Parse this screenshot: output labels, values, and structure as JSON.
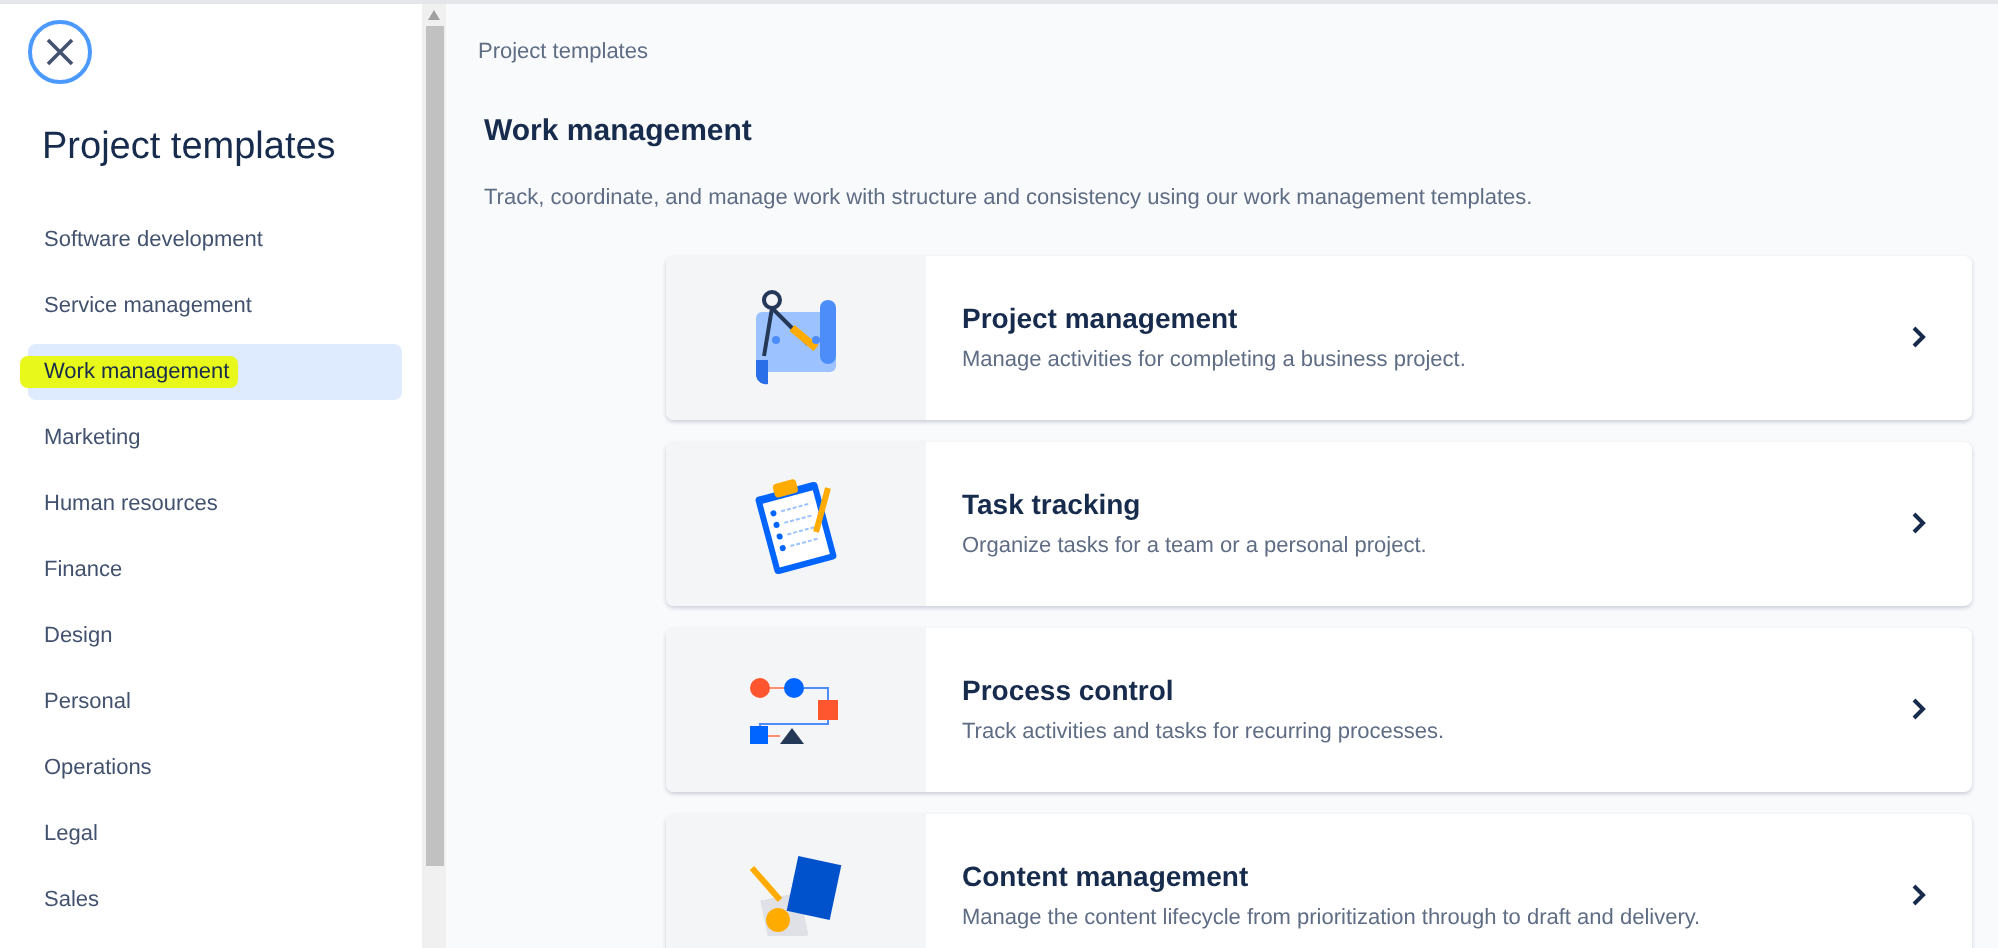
{
  "sidebar": {
    "title": "Project templates",
    "items": [
      {
        "label": "Software development",
        "selected": false,
        "highlighted": false
      },
      {
        "label": "Service management",
        "selected": false,
        "highlighted": false
      },
      {
        "label": "Work management",
        "selected": true,
        "highlighted": true
      },
      {
        "label": "Marketing",
        "selected": false,
        "highlighted": false
      },
      {
        "label": "Human resources",
        "selected": false,
        "highlighted": false
      },
      {
        "label": "Finance",
        "selected": false,
        "highlighted": false
      },
      {
        "label": "Design",
        "selected": false,
        "highlighted": false
      },
      {
        "label": "Personal",
        "selected": false,
        "highlighted": false
      },
      {
        "label": "Operations",
        "selected": false,
        "highlighted": false
      },
      {
        "label": "Legal",
        "selected": false,
        "highlighted": false
      },
      {
        "label": "Sales",
        "selected": false,
        "highlighted": false
      }
    ]
  },
  "breadcrumb": "Project templates",
  "heading": "Work management",
  "description": "Track, coordinate, and manage work with structure and consistency using our work management templates.",
  "templates": [
    {
      "kind": "blueprint",
      "title": "Project management",
      "subtitle": "Manage activities for completing a business project."
    },
    {
      "kind": "clipboard",
      "title": "Task tracking",
      "subtitle": "Organize tasks for a team or a personal project."
    },
    {
      "kind": "flow",
      "title": "Process control",
      "subtitle": "Track activities and tasks for recurring processes."
    },
    {
      "kind": "document",
      "title": "Content management",
      "subtitle": "Manage the content lifecycle from prioritization through to draft and delivery."
    }
  ]
}
